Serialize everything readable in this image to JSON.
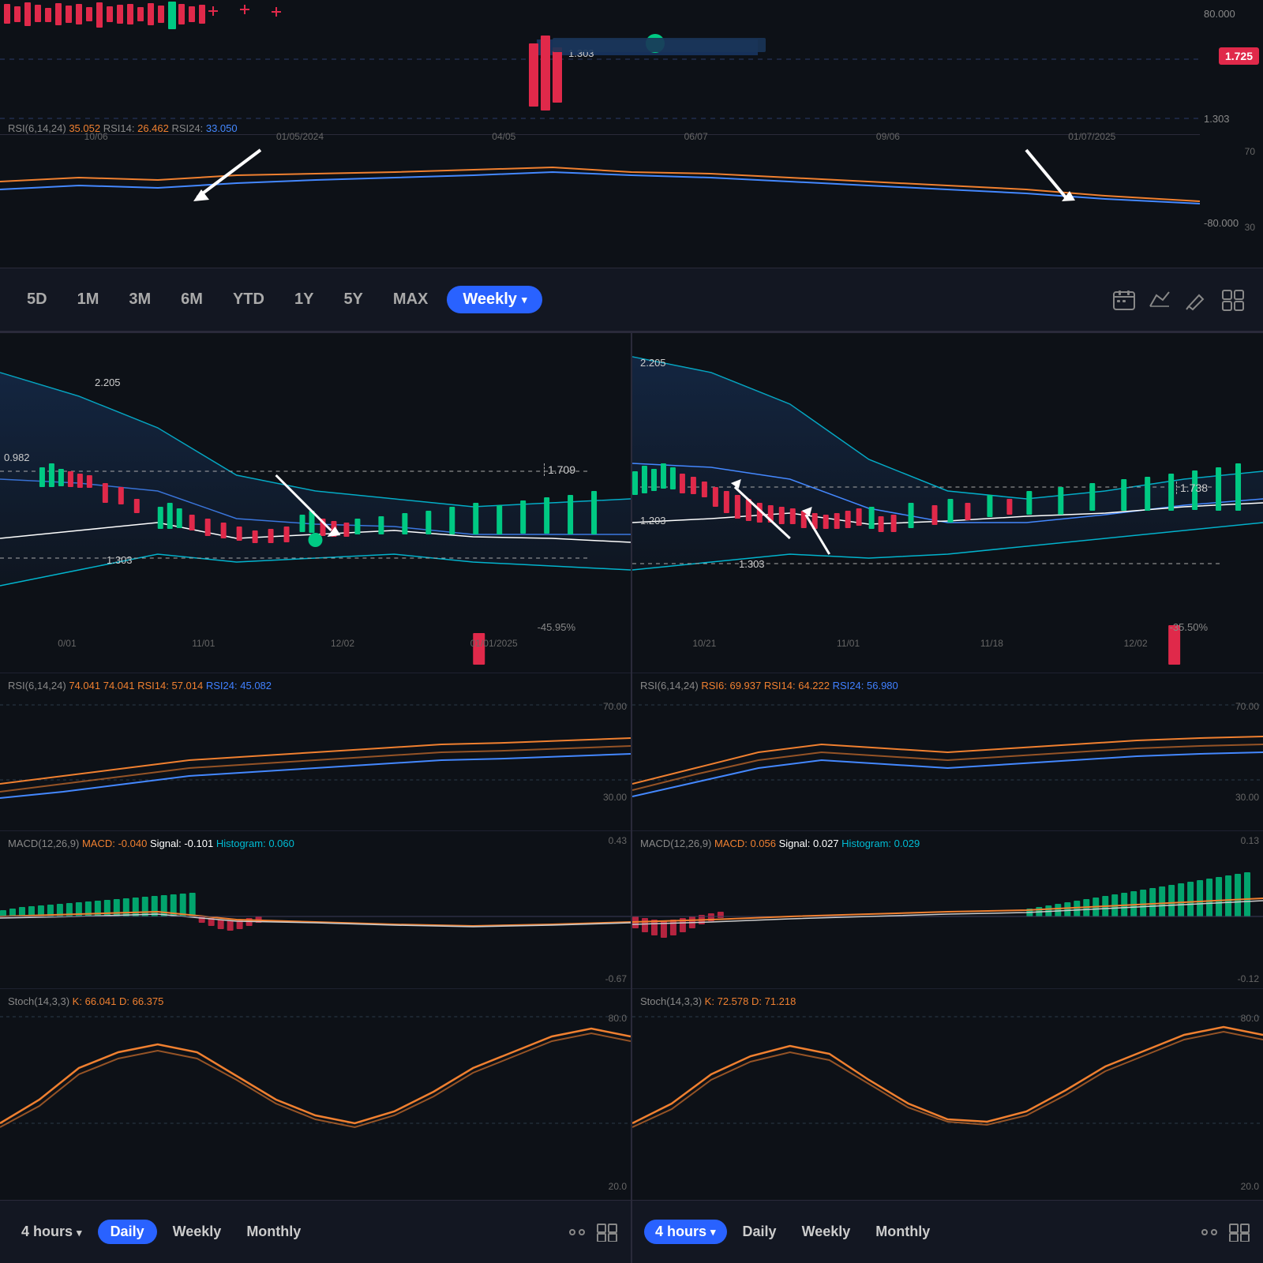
{
  "top": {
    "dates": [
      "10/06",
      "01/05/2024",
      "04/05",
      "06/07",
      "09/06",
      "01/07/2025"
    ],
    "price_badge": "1.725",
    "y_labels": [
      "80.000",
      "1.303",
      "-80.000"
    ],
    "rsi_label": "RSI(6,14,24)",
    "rsi6": "35.052",
    "rsi14": "26.462",
    "rsi24": "33.050",
    "rsi_y": [
      "70",
      "30"
    ],
    "toolbar": {
      "buttons": [
        "5D",
        "1M",
        "3M",
        "6M",
        "YTD",
        "1Y",
        "5Y",
        "MAX"
      ],
      "active": "Weekly",
      "dropdown_arrow": "▾"
    }
  },
  "panel_left": {
    "price_high": "2.205",
    "price_current": "1.709",
    "price_low": "0.982",
    "price_ref": "1.303",
    "percent": "-45.95%",
    "dates": [
      "0/01",
      "11/01",
      "12/02",
      "01/01/2025"
    ],
    "rsi": {
      "label": "RSI(6,14,24)",
      "rsi6": "74.041",
      "rsi14": "57.014",
      "rsi24": "45.082",
      "y_high": "70.00",
      "y_low": "30.00"
    },
    "macd": {
      "label": "MACD(12,26,9)",
      "macd": "-0.040",
      "signal": "-0.101",
      "histogram": "0.060",
      "y_high": "0.43",
      "y_low": "-0.67"
    },
    "stoch": {
      "label": "Stoch(14,3,3)",
      "k": "66.041",
      "d": "66.375",
      "y_high": "80.0",
      "y_low": "20.0"
    },
    "toolbar": {
      "interval": "4 hours",
      "active": "Daily",
      "buttons": [
        "Daily",
        "Weekly",
        "Monthly"
      ],
      "dropdown_arrow": "▾"
    }
  },
  "panel_right": {
    "price_high": "2.205",
    "price_current": "1.738",
    "price_low": "1.203",
    "price_ref": "1.303",
    "percent": "-35.50%",
    "dates": [
      "10/21",
      "11/01",
      "11/18",
      "12/02"
    ],
    "rsi": {
      "label": "RSI(6,14,24)",
      "rsi6": "69.937",
      "rsi14": "64.222",
      "rsi24": "56.980",
      "y_high": "70.00",
      "y_low": "30.00"
    },
    "macd": {
      "label": "MACD(12,26,9)",
      "macd": "0.056",
      "signal": "0.027",
      "histogram": "0.029",
      "y_high": "0.13",
      "y_low": "-0.12"
    },
    "stoch": {
      "label": "Stoch(14,3,3)",
      "k": "72.578",
      "d": "71.218",
      "y_high": "80.0",
      "y_low": "20.0"
    },
    "toolbar": {
      "interval": "4 hours",
      "active_interval": true,
      "buttons": [
        "Daily",
        "Weekly",
        "Monthly"
      ],
      "dropdown_arrow": "▾"
    }
  }
}
